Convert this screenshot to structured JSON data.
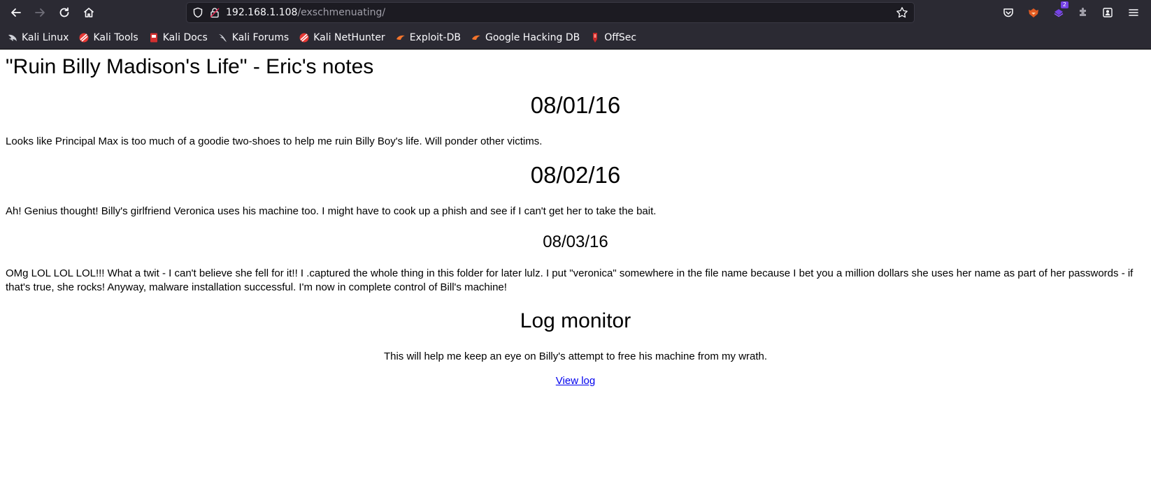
{
  "browser": {
    "url_host": "192.168.1.108",
    "url_path": "/exschmenuating/",
    "extension_badge": "2",
    "bookmarks": [
      {
        "label": "Kali Linux",
        "icon": "kali-dragon-icon"
      },
      {
        "label": "Kali Tools",
        "icon": "kali-tools-icon"
      },
      {
        "label": "Kali Docs",
        "icon": "kali-docs-icon"
      },
      {
        "label": "Kali Forums",
        "icon": "kali-dragon-icon"
      },
      {
        "label": "Kali NetHunter",
        "icon": "kali-nethunter-icon"
      },
      {
        "label": "Exploit-DB",
        "icon": "exploit-db-icon"
      },
      {
        "label": "Google Hacking DB",
        "icon": "exploit-db-icon"
      },
      {
        "label": "OffSec",
        "icon": "offsec-icon"
      }
    ]
  },
  "page": {
    "title": "\"Ruin Billy Madison's Life\" - Eric's notes",
    "entries": [
      {
        "date": "08/01/16",
        "text": "Looks like Principal Max is too much of a goodie two-shoes to help me ruin Billy Boy's life. Will ponder other victims."
      },
      {
        "date": "08/02/16",
        "text": "Ah! Genius thought! Billy's girlfriend Veronica uses his machine too. I might have to cook up a phish and see if I can't get her to take the bait."
      },
      {
        "date": "08/03/16",
        "text": "OMg LOL LOL LOL!!! What a twit - I can't believe she fell for it!! I .captured the whole thing in this folder for later lulz. I put \"veronica\" somewhere in the file name because I bet you a million dollars she uses her name as part of her passwords - if that's true, she rocks! Anyway, malware installation successful. I'm now in complete control of Bill's machine!"
      }
    ],
    "log_heading": "Log monitor",
    "log_description": "This will help me keep an eye on Billy's attempt to free his machine from my wrath.",
    "log_link": "View log"
  }
}
